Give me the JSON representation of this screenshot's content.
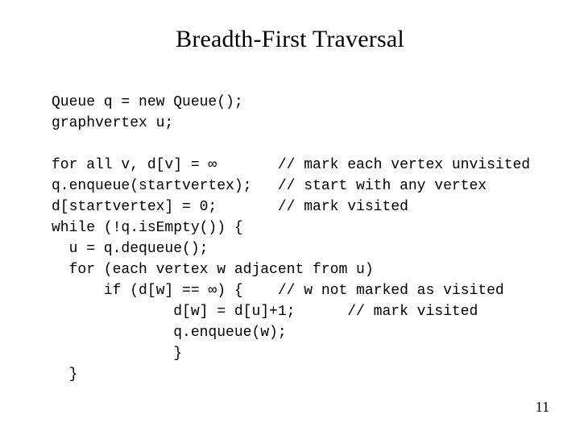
{
  "title": "Breadth-First Traversal",
  "code": {
    "l01": "Queue q = new Queue();",
    "l02": "graphvertex u;",
    "l03": "",
    "l04": "for all v, d[v] = ∞       // mark each vertex unvisited",
    "l05": "q.enqueue(startvertex);   // start with any vertex",
    "l06": "d[startvertex] = 0;       // mark visited",
    "l07": "while (!q.isEmpty()) {",
    "l08": "  u = q.dequeue();",
    "l09": "  for (each vertex w adjacent from u)",
    "l10": "      if (d[w] == ∞) {    // w not marked as visited",
    "l11": "              d[w] = d[u]+1;      // mark visited",
    "l12": "              q.enqueue(w);",
    "l13": "              }",
    "l14": "  }"
  },
  "page_number": "11"
}
